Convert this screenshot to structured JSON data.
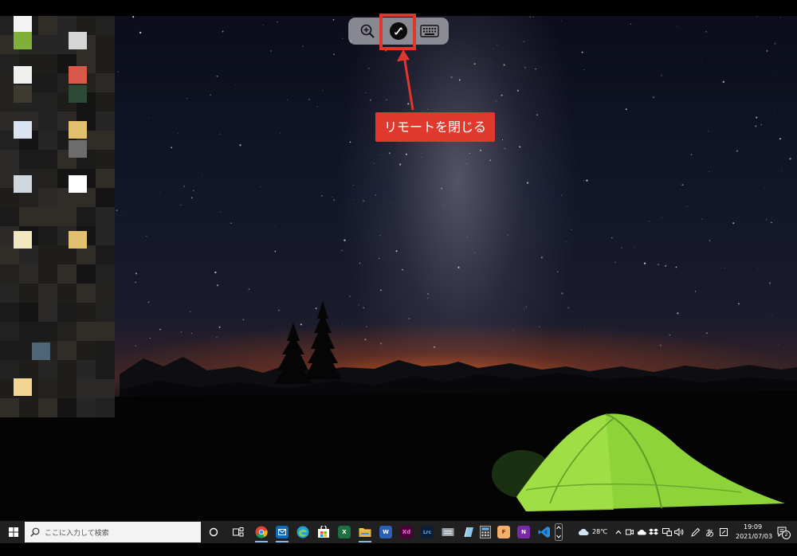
{
  "remote_toolbar": {
    "buttons": [
      {
        "icon": "zoom-in-icon"
      },
      {
        "icon": "remote-disconnect-icon"
      },
      {
        "icon": "keyboard-icon"
      }
    ]
  },
  "annotation": {
    "callout_label": "リモートを閉じる",
    "highlight_color": "#e0362c"
  },
  "taskbar": {
    "search": {
      "placeholder": "ここに入力して検索"
    },
    "apps": [
      {
        "name": "chrome",
        "label": ""
      },
      {
        "name": "mail",
        "label": ""
      },
      {
        "name": "edge",
        "label": ""
      },
      {
        "name": "store",
        "label": ""
      },
      {
        "name": "excel",
        "label": "X"
      },
      {
        "name": "file-explorer",
        "label": ""
      },
      {
        "name": "word",
        "label": "W"
      },
      {
        "name": "xd",
        "label": "Xd"
      },
      {
        "name": "lightroom-classic",
        "label": "Lrc"
      },
      {
        "name": "keyboard-app",
        "label": ""
      },
      {
        "name": "notes-app",
        "label": ""
      },
      {
        "name": "calculator",
        "label": ""
      },
      {
        "name": "f-app",
        "label": "F"
      },
      {
        "name": "onenote",
        "label": "N"
      },
      {
        "name": "vscode",
        "label": ""
      }
    ],
    "tray": {
      "weather": "28℃",
      "ime": "あ",
      "time": "19:09",
      "date": "2021/07/03",
      "notification_count": "2"
    }
  }
}
